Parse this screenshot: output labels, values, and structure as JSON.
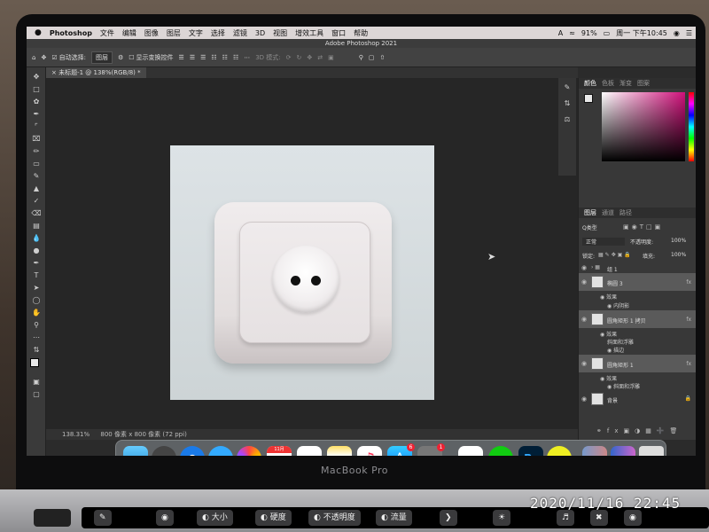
{
  "menubar": {
    "apple": "",
    "items": [
      "Photoshop",
      "文件",
      "编辑",
      "图像",
      "图层",
      "文字",
      "选择",
      "滤镜",
      "3D",
      "视图",
      "增效工具",
      "窗口",
      "帮助"
    ],
    "battery": "91%",
    "clock": "周一 下午10:45"
  },
  "window": {
    "title": "Adobe Photoshop 2021"
  },
  "options": {
    "auto_select_label": "自动选择:",
    "auto_select_value": "图层",
    "show_transform_label": "显示变换控件",
    "mode_3d_label": "3D 模式:"
  },
  "document": {
    "tab_label": "未标题-1 @ 138%(RGB/8) *",
    "zoom": "138.31%",
    "size_info": "800 像素 x 800 像素 (72 ppi)"
  },
  "color_panel": {
    "tabs": [
      "颜色",
      "色板",
      "渐变",
      "图案"
    ]
  },
  "layers_panel": {
    "tabs": [
      "图层",
      "通道",
      "路径"
    ],
    "filter_label": "Q类型",
    "blend_mode": "正常",
    "opacity_label": "不透明度:",
    "opacity_value": "100%",
    "lock_label": "锁定:",
    "fill_label": "填充:",
    "fill_value": "100%",
    "layers": [
      {
        "name": "组 1",
        "kind": "group"
      },
      {
        "name": "椭圆 3",
        "fx": "fx",
        "effects_label": "效果",
        "effects": [
          "内阴影"
        ]
      },
      {
        "name": "圆角矩形 1 拷贝",
        "fx": "fx",
        "effects_label": "效果",
        "effects": [
          "斜面和浮雕",
          "描边"
        ]
      },
      {
        "name": "圆角矩形 1",
        "fx": "fx",
        "effects_label": "效果",
        "effects": [
          "斜面和浮雕"
        ]
      },
      {
        "name": "背景",
        "kind": "background"
      }
    ]
  },
  "dock": {
    "calendar_month": "11月",
    "calendar_day": "16",
    "appstore_badge": "6",
    "prefs_badge": "1"
  },
  "laptop": {
    "model": "MacBook Pro"
  },
  "touchbar": {
    "buttons": [
      "大小",
      "硬度",
      "不透明度",
      "流量"
    ]
  },
  "photo_timestamp": "2020/11/16  22:45",
  "colors": {
    "ps_bg": "#2b2b2b",
    "panel": "#383838",
    "accent_picker": "#d0107a"
  }
}
